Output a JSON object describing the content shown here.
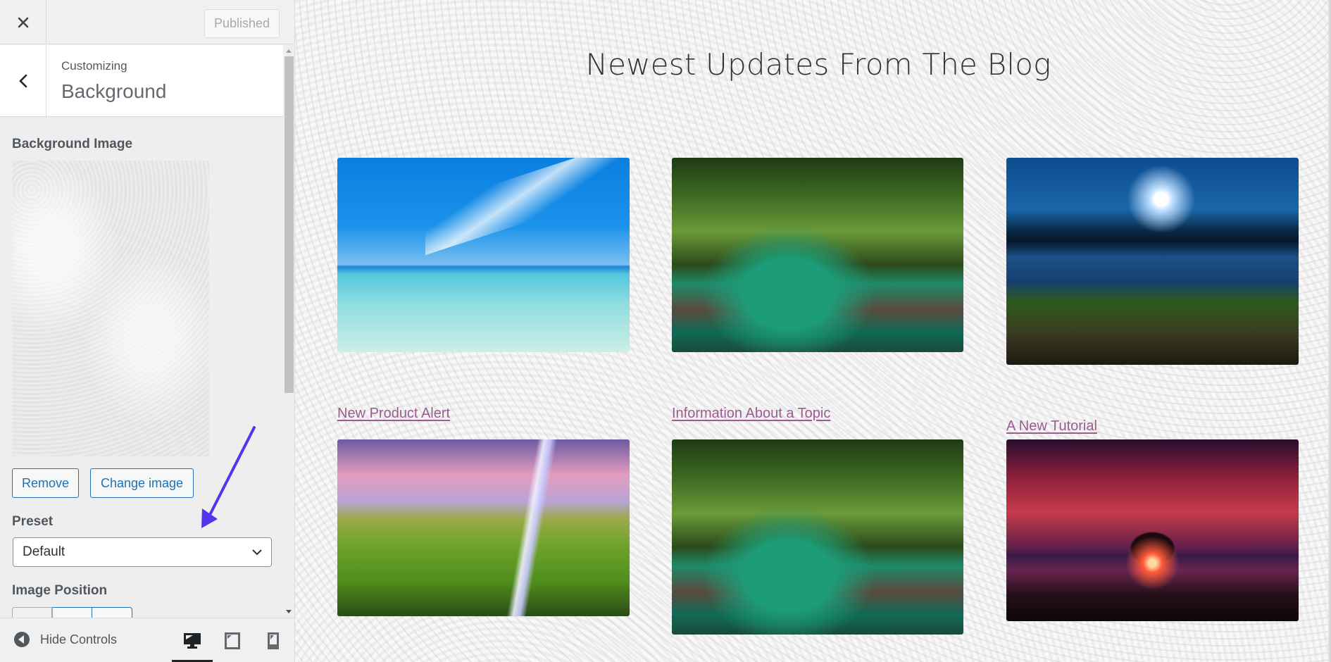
{
  "header": {
    "close_label": "Close",
    "publish_label": "Published"
  },
  "section": {
    "breadcrumb": "Customizing",
    "title": "Background"
  },
  "controls": {
    "background_image_label": "Background Image",
    "remove_label": "Remove",
    "change_image_label": "Change image",
    "preset_label": "Preset",
    "preset_value": "Default",
    "image_position_label": "Image Position"
  },
  "footer": {
    "hide_controls_label": "Hide Controls",
    "devices": [
      {
        "name": "desktop",
        "active": true
      },
      {
        "name": "tablet",
        "active": false
      },
      {
        "name": "mobile",
        "active": false
      }
    ]
  },
  "annotation": {
    "arrow_color": "#5533ee"
  },
  "preview": {
    "heading": "Newest Updates From The Blog",
    "posts": [
      {
        "title": "",
        "image": "beach"
      },
      {
        "title": "",
        "image": "river"
      },
      {
        "title": "",
        "image": "lake-dock"
      },
      {
        "title": "New Product Alert",
        "image": "waterfall"
      },
      {
        "title": "Information About a Topic",
        "image": "river"
      },
      {
        "title": "A New Tutorial",
        "image": "sunset-tree"
      }
    ],
    "link_color": "#9b5c8f"
  },
  "colors": {
    "wp_blue": "#2271b1",
    "sidebar_bg": "#eeeeee"
  }
}
